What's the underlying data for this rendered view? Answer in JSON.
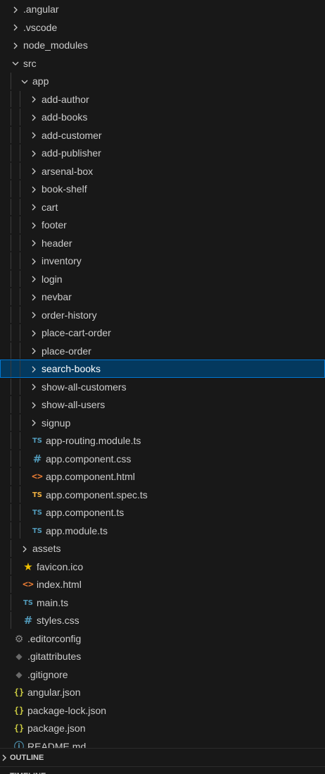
{
  "explorer": {
    "items": [
      {
        "label": "angular_prefix",
        "text": ".angular",
        "kind": "folder",
        "level": 0,
        "expanded": false,
        "icon": "chevron-right-icon"
      },
      {
        "text": ".vscode",
        "kind": "folder",
        "level": 0,
        "expanded": false,
        "icon": "chevron-right-icon"
      },
      {
        "text": "node_modules",
        "kind": "folder",
        "level": 0,
        "expanded": false,
        "icon": "chevron-right-icon"
      },
      {
        "text": "src",
        "kind": "folder",
        "level": 0,
        "expanded": true,
        "icon": "chevron-down-icon"
      },
      {
        "text": "app",
        "kind": "folder",
        "level": 1,
        "expanded": true,
        "icon": "chevron-down-icon"
      },
      {
        "text": "add-author",
        "kind": "folder",
        "level": 2,
        "expanded": false,
        "icon": "chevron-right-icon"
      },
      {
        "text": "add-books",
        "kind": "folder",
        "level": 2,
        "expanded": false,
        "icon": "chevron-right-icon"
      },
      {
        "text": "add-customer",
        "kind": "folder",
        "level": 2,
        "expanded": false,
        "icon": "chevron-right-icon"
      },
      {
        "text": "add-publisher",
        "kind": "folder",
        "level": 2,
        "expanded": false,
        "icon": "chevron-right-icon"
      },
      {
        "text": "arsenal-box",
        "kind": "folder",
        "level": 2,
        "expanded": false,
        "icon": "chevron-right-icon"
      },
      {
        "text": "book-shelf",
        "kind": "folder",
        "level": 2,
        "expanded": false,
        "icon": "chevron-right-icon"
      },
      {
        "text": "cart",
        "kind": "folder",
        "level": 2,
        "expanded": false,
        "icon": "chevron-right-icon"
      },
      {
        "text": "footer",
        "kind": "folder",
        "level": 2,
        "expanded": false,
        "icon": "chevron-right-icon"
      },
      {
        "text": "header",
        "kind": "folder",
        "level": 2,
        "expanded": false,
        "icon": "chevron-right-icon"
      },
      {
        "text": "inventory",
        "kind": "folder",
        "level": 2,
        "expanded": false,
        "icon": "chevron-right-icon"
      },
      {
        "text": "login",
        "kind": "folder",
        "level": 2,
        "expanded": false,
        "icon": "chevron-right-icon"
      },
      {
        "text": "nevbar",
        "kind": "folder",
        "level": 2,
        "expanded": false,
        "icon": "chevron-right-icon"
      },
      {
        "text": "order-history",
        "kind": "folder",
        "level": 2,
        "expanded": false,
        "icon": "chevron-right-icon"
      },
      {
        "text": "place-cart-order",
        "kind": "folder",
        "level": 2,
        "expanded": false,
        "icon": "chevron-right-icon"
      },
      {
        "text": "place-order",
        "kind": "folder",
        "level": 2,
        "expanded": false,
        "icon": "chevron-right-icon"
      },
      {
        "text": "search-books",
        "kind": "folder",
        "level": 2,
        "expanded": false,
        "icon": "chevron-right-icon",
        "selected": true
      },
      {
        "text": "show-all-customers",
        "kind": "folder",
        "level": 2,
        "expanded": false,
        "icon": "chevron-right-icon"
      },
      {
        "text": "show-all-users",
        "kind": "folder",
        "level": 2,
        "expanded": false,
        "icon": "chevron-right-icon"
      },
      {
        "text": "signup",
        "kind": "folder",
        "level": 2,
        "expanded": false,
        "icon": "chevron-right-icon"
      },
      {
        "text": "app-routing.module.ts",
        "kind": "file",
        "level": 2,
        "icon": "typescript-icon",
        "glyph": "TS"
      },
      {
        "text": "app.component.css",
        "kind": "file",
        "level": 2,
        "icon": "css-icon",
        "glyph": "#"
      },
      {
        "text": "app.component.html",
        "kind": "file",
        "level": 2,
        "icon": "html-icon",
        "glyph": "<>"
      },
      {
        "text": "app.component.spec.ts",
        "kind": "file",
        "level": 2,
        "icon": "typescript-test-icon",
        "glyph": "TS"
      },
      {
        "text": "app.component.ts",
        "kind": "file",
        "level": 2,
        "icon": "typescript-icon",
        "glyph": "TS"
      },
      {
        "text": "app.module.ts",
        "kind": "file",
        "level": 2,
        "icon": "typescript-icon",
        "glyph": "TS"
      },
      {
        "text": "assets",
        "kind": "folder",
        "level": 1,
        "expanded": false,
        "icon": "chevron-right-icon"
      },
      {
        "text": "favicon.ico",
        "kind": "file",
        "level": 1,
        "icon": "star-icon",
        "glyph": "★"
      },
      {
        "text": "index.html",
        "kind": "file",
        "level": 1,
        "icon": "html-icon",
        "glyph": "<>"
      },
      {
        "text": "main.ts",
        "kind": "file",
        "level": 1,
        "icon": "typescript-icon",
        "glyph": "TS"
      },
      {
        "text": "styles.css",
        "kind": "file",
        "level": 1,
        "icon": "css-icon",
        "glyph": "#"
      },
      {
        "text": ".editorconfig",
        "kind": "file",
        "level": 0,
        "icon": "gear-icon",
        "glyph": "⚙"
      },
      {
        "text": ".gitattributes",
        "kind": "file",
        "level": 0,
        "icon": "git-icon",
        "glyph": "◆"
      },
      {
        "text": ".gitignore",
        "kind": "file",
        "level": 0,
        "icon": "git-icon",
        "glyph": "◆"
      },
      {
        "text": "angular.json",
        "kind": "file",
        "level": 0,
        "icon": "json-icon",
        "glyph": "{}"
      },
      {
        "text": "package-lock.json",
        "kind": "file",
        "level": 0,
        "icon": "json-icon",
        "glyph": "{}"
      },
      {
        "text": "package.json",
        "kind": "file",
        "level": 0,
        "icon": "json-icon",
        "glyph": "{}"
      },
      {
        "text": "README.md",
        "kind": "file",
        "level": 0,
        "icon": "info-icon",
        "glyph": "ⓘ"
      }
    ]
  },
  "sections": {
    "outline": "OUTLINE",
    "timeline": "TIMELINE"
  },
  "colors": {
    "background": "#181818",
    "selected_background": "#04395e",
    "selected_border": "#0078d4",
    "text": "#cccccc",
    "typescript": "#519aba",
    "typescript_test": "#f0b040",
    "html": "#e37933",
    "json": "#cbcb41"
  }
}
